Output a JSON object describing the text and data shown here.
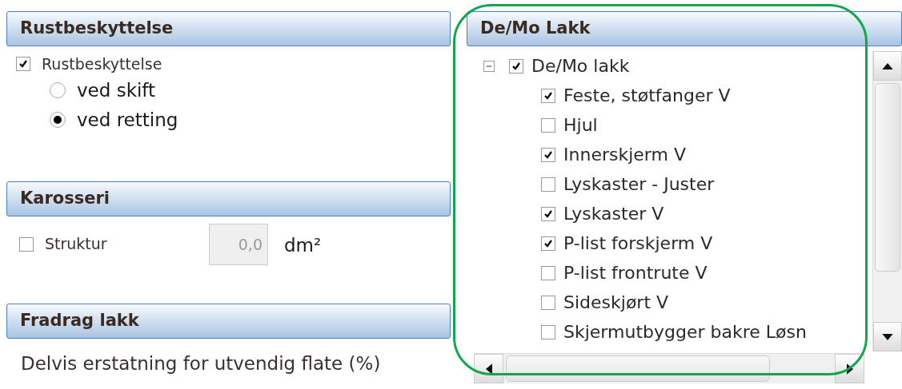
{
  "left_panel": {
    "sections": [
      {
        "title": "Rustbeskyttelse",
        "kind": "rust",
        "checkbox": {
          "label": "Rustbeskyttelse",
          "checked": true
        },
        "radios": [
          {
            "label": "ved skift",
            "selected": false
          },
          {
            "label": "ved retting",
            "selected": true
          }
        ]
      },
      {
        "title": "Karosseri",
        "kind": "body",
        "checkbox": {
          "label": "Struktur",
          "checked": false
        },
        "field": {
          "value": "0,0",
          "disabled": true
        },
        "unit": "dm²"
      },
      {
        "title": "Fradrag lakk",
        "kind": "text",
        "text": "Delvis erstatning for utvendig flate (%)"
      }
    ]
  },
  "right_panel": {
    "title": "De/Mo Lakk",
    "tree": [
      {
        "label": "De/Mo lakk",
        "checked": true,
        "expanded": true,
        "children": [
          {
            "label": "Feste, støtfanger V",
            "checked": true
          },
          {
            "label": "Hjul",
            "checked": false
          },
          {
            "label": "Innerskjerm V",
            "checked": true
          },
          {
            "label": "Lyskaster - Juster",
            "checked": false
          },
          {
            "label": "Lyskaster V",
            "checked": true
          },
          {
            "label": "P-list forskjerm V",
            "checked": true
          },
          {
            "label": "P-list frontrute V",
            "checked": false
          },
          {
            "label": "Sideskjørt V",
            "checked": false
          },
          {
            "label": "Skjermutbygger bakre Løsn",
            "checked": false
          }
        ]
      }
    ]
  }
}
